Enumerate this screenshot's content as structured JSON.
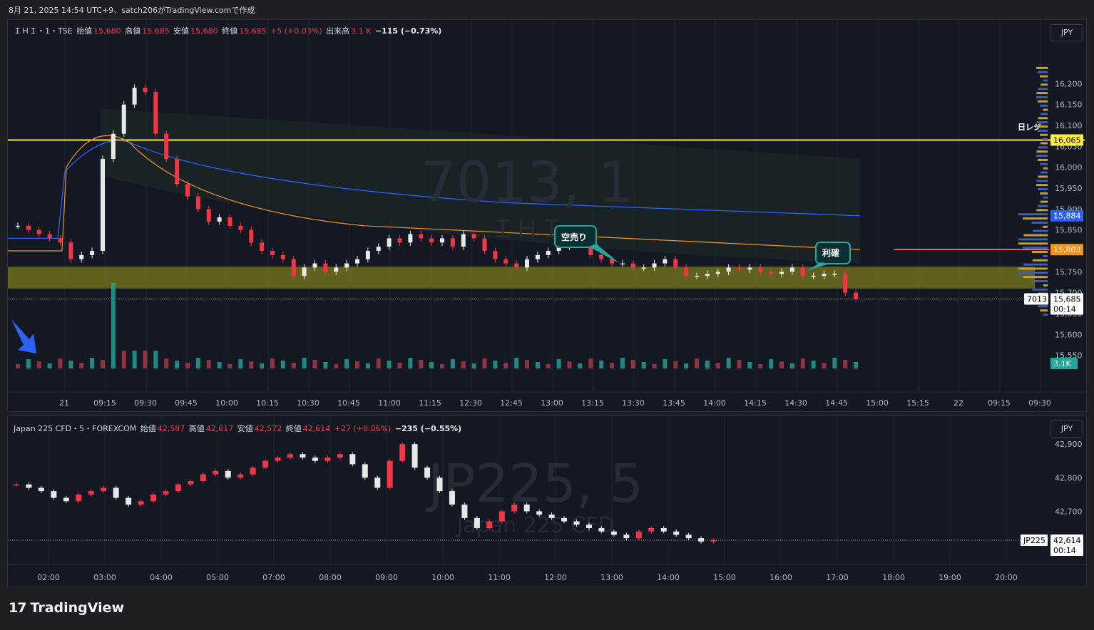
{
  "caption": "8月 21, 2025 14:54 UTC+9、satch206がTradingView.comで作成",
  "brand": "TradingView",
  "pane1": {
    "symbol_line": "ＩＨＩ・1・TSE",
    "open_label": "始値",
    "open": "15,680",
    "high_label": "高値",
    "high": "15,685",
    "low_label": "安値",
    "low": "15,680",
    "close_label": "終値",
    "close": "15,685",
    "change": "+5 (+0.03%)",
    "volume_label": "出来高",
    "volume": "3.1 K",
    "day_change": "−115 (−0.73%)",
    "currency": "JPY",
    "watermark": "7013, 1",
    "watermark_sub": "ＩＨＩ",
    "annotations": {
      "short": "空売り",
      "profit": "利確",
      "resistance": "日レジ"
    },
    "price_tags": {
      "resistance": "16,065",
      "vwap": "15,884",
      "ma": "15,803",
      "last": "15,685",
      "countdown": "00:14",
      "ticker": "7013",
      "volume": "3.1K"
    },
    "x_labels": [
      "21",
      "09:15",
      "09:30",
      "09:45",
      "10:00",
      "10:15",
      "10:30",
      "10:45",
      "11:00",
      "11:15",
      "12:30",
      "12:45",
      "13:00",
      "13:15",
      "13:30",
      "13:45",
      "14:00",
      "14:15",
      "14:30",
      "14:45",
      "15:00",
      "15:15",
      "22",
      "09:15",
      "09:30"
    ],
    "y_labels": [
      "16,200",
      "16,150",
      "16,100",
      "16,050",
      "16,000",
      "15,950",
      "15,900",
      "15,850",
      "15,800",
      "15,750",
      "15,700",
      "15,650",
      "15,600",
      "15,550"
    ],
    "colors": {
      "up": "#e8e8e8",
      "down": "#f23645",
      "vwap": "#2962ff",
      "ma": "#f7931a",
      "zone": "#7a7a1e",
      "resistance": "#ffeb3b"
    }
  },
  "pane2": {
    "symbol_line": "Japan 225 CFD・5・FOREXCOM",
    "open_label": "始値",
    "open": "42,587",
    "high_label": "高値",
    "high": "42,617",
    "low_label": "安値",
    "low": "42,572",
    "close_label": "終値",
    "close": "42,614",
    "change": "+27 (+0.06%)",
    "day_change": "−235 (−0.55%)",
    "currency": "JPY",
    "watermark": "JP225, 5",
    "watermark_sub": "Japan 225 CFD",
    "price_tags": {
      "last": "42,614",
      "countdown": "00:14",
      "ticker": "JP225"
    },
    "x_labels": [
      "02:00",
      "03:00",
      "04:00",
      "05:00",
      "07:00",
      "08:00",
      "09:00",
      "10:00",
      "11:00",
      "12:00",
      "13:00",
      "14:00",
      "15:00",
      "16:00",
      "17:00",
      "18:00",
      "19:00",
      "20:00"
    ],
    "y_labels": [
      "42,900",
      "42,800",
      "42,700"
    ]
  },
  "chart_data": [
    {
      "type": "candlestick",
      "title": "ＩＨＩ・1・TSE",
      "ylim": [
        15500,
        16250
      ],
      "series_close": [
        15860,
        15850,
        15840,
        15830,
        15820,
        15780,
        15790,
        15800,
        16020,
        16080,
        16150,
        16190,
        16180,
        16080,
        16020,
        15960,
        15930,
        15900,
        15870,
        15880,
        15860,
        15850,
        15820,
        15800,
        15790,
        15780,
        15740,
        15760,
        15770,
        15750,
        15760,
        15770,
        15780,
        15800,
        15810,
        15830,
        15820,
        15840,
        15830,
        15820,
        15830,
        15810,
        15840,
        15830,
        15800,
        15780,
        15770,
        15760,
        15780,
        15790,
        15800,
        15810,
        15830,
        15840,
        15790,
        15780,
        15770,
        15770,
        15760,
        15760,
        15770,
        15780,
        15760,
        15740,
        15740,
        15745,
        15750,
        15760,
        15755,
        15760,
        15750,
        15745,
        15750,
        15760,
        15740,
        15740,
        15745,
        15745,
        15700,
        15685
      ],
      "annotations": [
        "空売り",
        "利確",
        "日レジ"
      ],
      "levels": {
        "resistance": 16065,
        "vwap": 15884,
        "ma": 15803,
        "last": 15685
      }
    },
    {
      "type": "candlestick",
      "title": "Japan 225 CFD・5・FOREXCOM",
      "ylim": [
        42580,
        42930
      ],
      "series_close": [
        42780,
        42770,
        42760,
        42740,
        42730,
        42750,
        42760,
        42770,
        42740,
        42720,
        42730,
        42750,
        42760,
        42780,
        42790,
        42810,
        42820,
        42800,
        42810,
        42830,
        42850,
        42860,
        42870,
        42860,
        42850,
        42860,
        42870,
        42840,
        42800,
        42770,
        42850,
        42900,
        42830,
        42800,
        42760,
        42720,
        42680,
        42650,
        42670,
        42700,
        42720,
        42700,
        42690,
        42680,
        42670,
        42660,
        42650,
        42640,
        42630,
        42620,
        42640,
        42650,
        42640,
        42630,
        42620,
        42610,
        42614
      ],
      "last": 42614
    }
  ]
}
